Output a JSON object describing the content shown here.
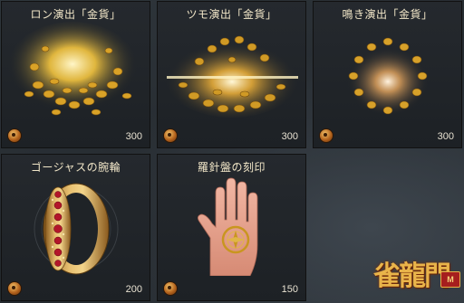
{
  "shop": {
    "items": [
      {
        "title": "ロン演出「金貨」",
        "price": "300",
        "icon": "gold-coin-burst"
      },
      {
        "title": "ツモ演出「金貨」",
        "price": "300",
        "icon": "gold-coin-explosion"
      },
      {
        "title": "鳴き演出「金貨」",
        "price": "300",
        "icon": "gold-coin-ring"
      },
      {
        "title": "ゴージャスの腕輪",
        "price": "200",
        "icon": "jeweled-bracelet"
      },
      {
        "title": "羅針盤の刻印",
        "price": "150",
        "icon": "compass-hand-tattoo"
      }
    ],
    "currency_icon": "coin-icon"
  },
  "logo": {
    "text": "雀龍門",
    "badge": "M"
  },
  "colors": {
    "gold": "#e9b44a",
    "title_text": "#f1e6c8",
    "card_bg": "#1f2327"
  }
}
